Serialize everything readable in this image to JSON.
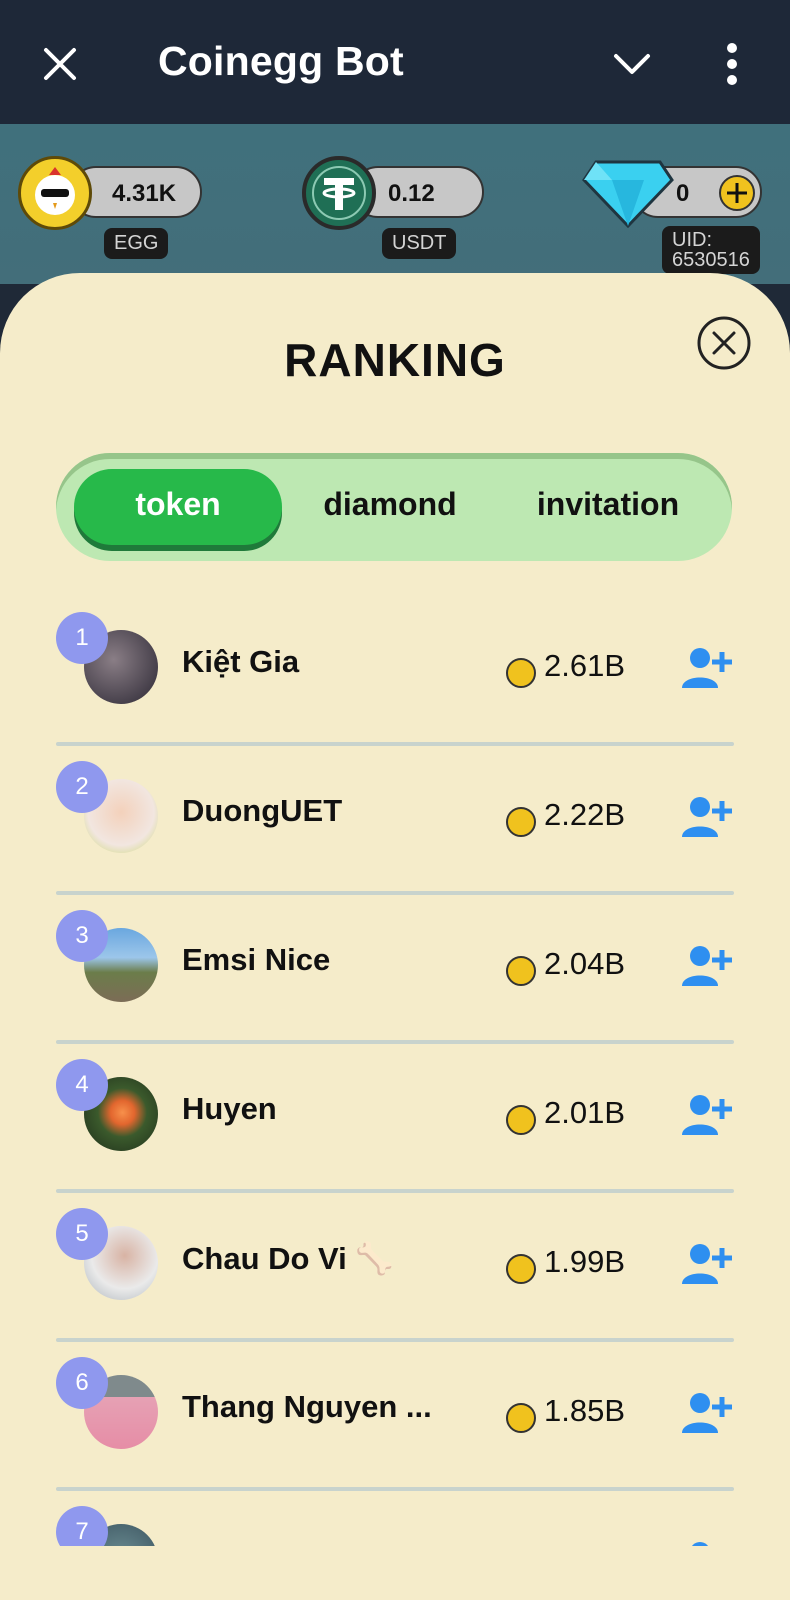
{
  "header": {
    "title": "Coinegg Bot"
  },
  "resources": [
    {
      "value": "4.31K",
      "tag": "EGG",
      "icon": "egg-chicken-icon"
    },
    {
      "value": "0.12",
      "tag": "USDT",
      "icon": "usdt-icon"
    },
    {
      "value": "0",
      "tag": "UID:\n6530516",
      "icon": "diamond-icon"
    }
  ],
  "panel": {
    "title": "RANKING",
    "tabs": [
      {
        "label": "token",
        "active": true
      },
      {
        "label": "diamond",
        "active": false
      },
      {
        "label": "invitation",
        "active": false
      }
    ]
  },
  "ranking": [
    {
      "rank": "1",
      "name": "Kiệt Gia",
      "score": "2.61B"
    },
    {
      "rank": "2",
      "name": "DuongUET",
      "score": "2.22B"
    },
    {
      "rank": "3",
      "name": "Emsi Nice",
      "score": "2.04B"
    },
    {
      "rank": "4",
      "name": "Huyen",
      "score": "2.01B"
    },
    {
      "rank": "5",
      "name": "Chau Do Vi 🦴",
      "score": "1.99B"
    },
    {
      "rank": "6",
      "name": "Thang Nguyen ...",
      "score": "1.85B"
    },
    {
      "rank": "7",
      "name": "",
      "score": ""
    }
  ],
  "colors": {
    "accent_green": "#27b94a",
    "panel_bg": "#f5ecca",
    "badge": "#8f98ee",
    "add_user": "#2e8ff0"
  }
}
